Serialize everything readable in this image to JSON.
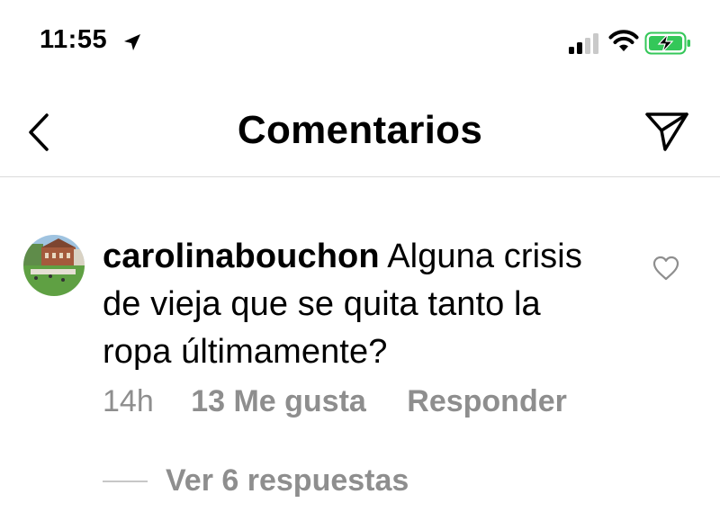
{
  "status_bar": {
    "time": "11:55",
    "battery_color": "#34c759",
    "icons": [
      "location-arrow-icon",
      "cellular-signal-icon",
      "wifi-icon",
      "battery-charging-icon"
    ]
  },
  "header": {
    "title": "Comentarios",
    "back_icon": "chevron-left-icon",
    "share_icon": "paper-plane-icon"
  },
  "comment": {
    "username": "carolinabouchon",
    "text": "Alguna crisis de vieja que se quita tanto la ropa últimamente?",
    "time_ago": "14h",
    "likes_label": "13 Me gusta",
    "reply_label": "Responder",
    "view_replies_label": "Ver 6 respuestas",
    "like_icon": "heart-outline-icon"
  },
  "colors": {
    "text_primary": "#000000",
    "text_secondary": "#8e8e8e",
    "divider": "#dbdbdb"
  }
}
